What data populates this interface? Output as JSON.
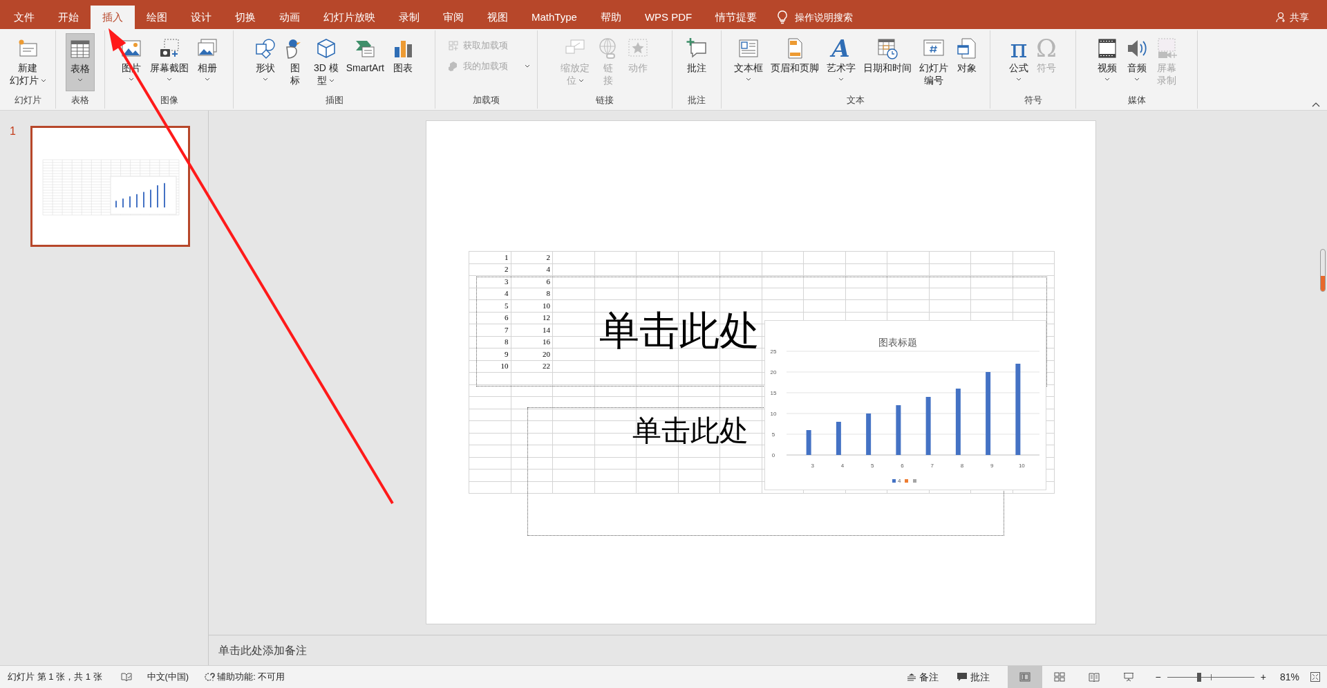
{
  "tabs": [
    {
      "label": "文件",
      "selected": false
    },
    {
      "label": "开始",
      "selected": false
    },
    {
      "label": "插入",
      "selected": true
    },
    {
      "label": "绘图",
      "selected": false
    },
    {
      "label": "设计",
      "selected": false
    },
    {
      "label": "切换",
      "selected": false
    },
    {
      "label": "动画",
      "selected": false
    },
    {
      "label": "幻灯片放映",
      "selected": false
    },
    {
      "label": "录制",
      "selected": false
    },
    {
      "label": "审阅",
      "selected": false
    },
    {
      "label": "视图",
      "selected": false
    },
    {
      "label": "MathType",
      "selected": false
    },
    {
      "label": "帮助",
      "selected": false
    },
    {
      "label": "WPS PDF",
      "selected": false
    },
    {
      "label": "情节提要",
      "selected": false
    }
  ],
  "tell_me": "操作说明搜索",
  "share": "共享",
  "ribbon": {
    "groups": [
      {
        "label": "幻灯片",
        "buttons": [
          {
            "kind": "newslide",
            "lines": [
              "新建",
              "幻灯片"
            ],
            "dropdown": true,
            "disabled": false,
            "selected": false
          }
        ]
      },
      {
        "label": "表格",
        "buttons": [
          {
            "kind": "table",
            "lines": [
              "表格"
            ],
            "dropdown": true,
            "disabled": false,
            "selected": true
          }
        ]
      },
      {
        "label": "图像",
        "buttons": [
          {
            "kind": "picture",
            "lines": [
              "图片"
            ],
            "dropdown": true,
            "disabled": false,
            "selected": false
          },
          {
            "kind": "screenshot",
            "lines": [
              "屏幕截图"
            ],
            "dropdown": true,
            "disabled": false,
            "selected": false
          },
          {
            "kind": "album",
            "lines": [
              "相册"
            ],
            "dropdown": true,
            "disabled": false,
            "selected": false
          }
        ]
      },
      {
        "label": "插图",
        "buttons": [
          {
            "kind": "shapes",
            "lines": [
              "形状"
            ],
            "dropdown": true,
            "disabled": false,
            "selected": false
          },
          {
            "kind": "icons",
            "lines": [
              "图",
              "标"
            ],
            "dropdown": false,
            "disabled": false,
            "selected": false
          },
          {
            "kind": "model",
            "lines": [
              "3D 模",
              "型"
            ],
            "dropdown": true,
            "disabled": false,
            "selected": false
          },
          {
            "kind": "smartart",
            "lines": [
              "SmartArt"
            ],
            "dropdown": false,
            "disabled": false,
            "selected": false
          },
          {
            "kind": "chart",
            "lines": [
              "图表"
            ],
            "dropdown": false,
            "disabled": false,
            "selected": false
          }
        ]
      },
      {
        "label": "加载项",
        "buttons": [
          {
            "kind": "getaddins",
            "lines": [
              "获取加载项"
            ],
            "dropdown": false,
            "disabled": true,
            "selected": false
          },
          {
            "kind": "myaddins",
            "lines": [
              "我的加载项"
            ],
            "dropdown": true,
            "disabled": true,
            "selected": false
          }
        ]
      },
      {
        "label": "链接",
        "buttons": [
          {
            "kind": "zoom",
            "lines": [
              "缩放定",
              "位"
            ],
            "dropdown": true,
            "disabled": true,
            "selected": false
          },
          {
            "kind": "link",
            "lines": [
              "链",
              "接"
            ],
            "dropdown": false,
            "disabled": true,
            "selected": false
          },
          {
            "kind": "action",
            "lines": [
              "动作"
            ],
            "dropdown": false,
            "disabled": true,
            "selected": false
          }
        ]
      },
      {
        "label": "批注",
        "buttons": [
          {
            "kind": "comment",
            "lines": [
              "批注"
            ],
            "dropdown": false,
            "disabled": false,
            "selected": false
          }
        ]
      },
      {
        "label": "文本",
        "buttons": [
          {
            "kind": "textbox",
            "lines": [
              "文本框"
            ],
            "dropdown": true,
            "disabled": false,
            "selected": false
          },
          {
            "kind": "header",
            "lines": [
              "页眉和页脚"
            ],
            "dropdown": false,
            "disabled": false,
            "selected": false
          },
          {
            "kind": "wordart",
            "glyph": "A",
            "lines": [
              "艺术字"
            ],
            "dropdown": true,
            "disabled": false,
            "selected": false
          },
          {
            "kind": "datetime",
            "lines": [
              "日期和时间"
            ],
            "dropdown": false,
            "disabled": false,
            "selected": false
          },
          {
            "kind": "slidenumber",
            "lines": [
              "幻灯片",
              "编号"
            ],
            "dropdown": false,
            "disabled": false,
            "selected": false
          },
          {
            "kind": "object",
            "lines": [
              "对象"
            ],
            "dropdown": false,
            "disabled": false,
            "selected": false
          }
        ]
      },
      {
        "label": "符号",
        "buttons": [
          {
            "kind": "equation",
            "glyph": "π",
            "lines": [
              "公式"
            ],
            "dropdown": true,
            "disabled": false,
            "selected": false
          },
          {
            "kind": "symbol",
            "glyph": "Ω",
            "lines": [
              "符号"
            ],
            "dropdown": false,
            "disabled": true,
            "selected": false
          }
        ]
      },
      {
        "label": "媒体",
        "buttons": [
          {
            "kind": "video",
            "lines": [
              "视频"
            ],
            "dropdown": true,
            "disabled": false,
            "selected": false
          },
          {
            "kind": "audio",
            "lines": [
              "音频"
            ],
            "dropdown": true,
            "disabled": false,
            "selected": false
          },
          {
            "kind": "recording",
            "lines": [
              "屏幕",
              "录制"
            ],
            "dropdown": false,
            "disabled": true,
            "selected": false
          }
        ]
      }
    ]
  },
  "slides_panel": {
    "slides": [
      {
        "number": "1",
        "selected": true
      }
    ]
  },
  "slide": {
    "table": {
      "rows": [
        [
          "1",
          "2"
        ],
        [
          "2",
          "4"
        ],
        [
          "3",
          "6"
        ],
        [
          "4",
          "8"
        ],
        [
          "5",
          "10"
        ],
        [
          "6",
          "12"
        ],
        [
          "7",
          "14"
        ],
        [
          "8",
          "16"
        ],
        [
          "9",
          "20"
        ],
        [
          "10",
          "22"
        ]
      ]
    },
    "title_placeholder": "单击此处",
    "subtitle_placeholder": "单击此处",
    "chart_data": {
      "type": "bar",
      "title": "图表标题",
      "grid": true,
      "categories": [
        "3",
        "4",
        "5",
        "6",
        "7",
        "8",
        "9",
        "10"
      ],
      "ylim": [
        0,
        25
      ],
      "yticks": [
        0,
        5,
        10,
        15,
        20,
        25
      ],
      "series": [
        {
          "name": "4",
          "color": "#4472c4",
          "values": [
            6,
            8,
            10,
            12,
            14,
            16,
            20,
            22
          ]
        },
        {
          "color": "#ed7d31",
          "values": [
            null,
            null,
            null,
            null,
            null,
            null,
            null,
            null
          ]
        },
        {
          "color": "#a5a5a5",
          "values": [
            null,
            null,
            null,
            null,
            null,
            null,
            null,
            null
          ]
        }
      ]
    }
  },
  "notes": {
    "text": "单击此处添加备注"
  },
  "status_bar": {
    "slide_info": "幻灯片 第 1 张，共 1 张",
    "language": "中文(中国)",
    "accessibility": "辅助功能: 不可用",
    "notes_button": "备注",
    "comments_button": "批注",
    "views": [
      {
        "kind": "normal",
        "selected": true
      },
      {
        "kind": "sorter",
        "selected": false
      },
      {
        "kind": "reading",
        "selected": false
      },
      {
        "kind": "show",
        "selected": false
      }
    ],
    "zoom_out": "−",
    "zoom_in": "+",
    "zoom": {
      "level": 0.37,
      "reading": "81%"
    }
  }
}
